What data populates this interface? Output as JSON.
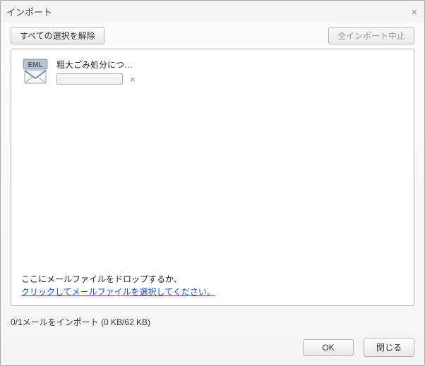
{
  "dialog": {
    "title": "インポート",
    "close_icon": "×"
  },
  "toolbar": {
    "deselect_all_label": "すべての選択を解除",
    "stop_all_label": "全インポート中止"
  },
  "items": [
    {
      "icon_label": "EML",
      "filename": "粗大ごみ処分につ…",
      "cancel_icon": "×"
    }
  ],
  "drop_hint": {
    "line1": "ここにメールファイルをドロップするか、",
    "link": "クリックしてメールファイルを選択してください。"
  },
  "status": "0/1メールをインポート (0 KB/62 KB)",
  "footer": {
    "ok_label": "OK",
    "close_label": "閉じる"
  }
}
